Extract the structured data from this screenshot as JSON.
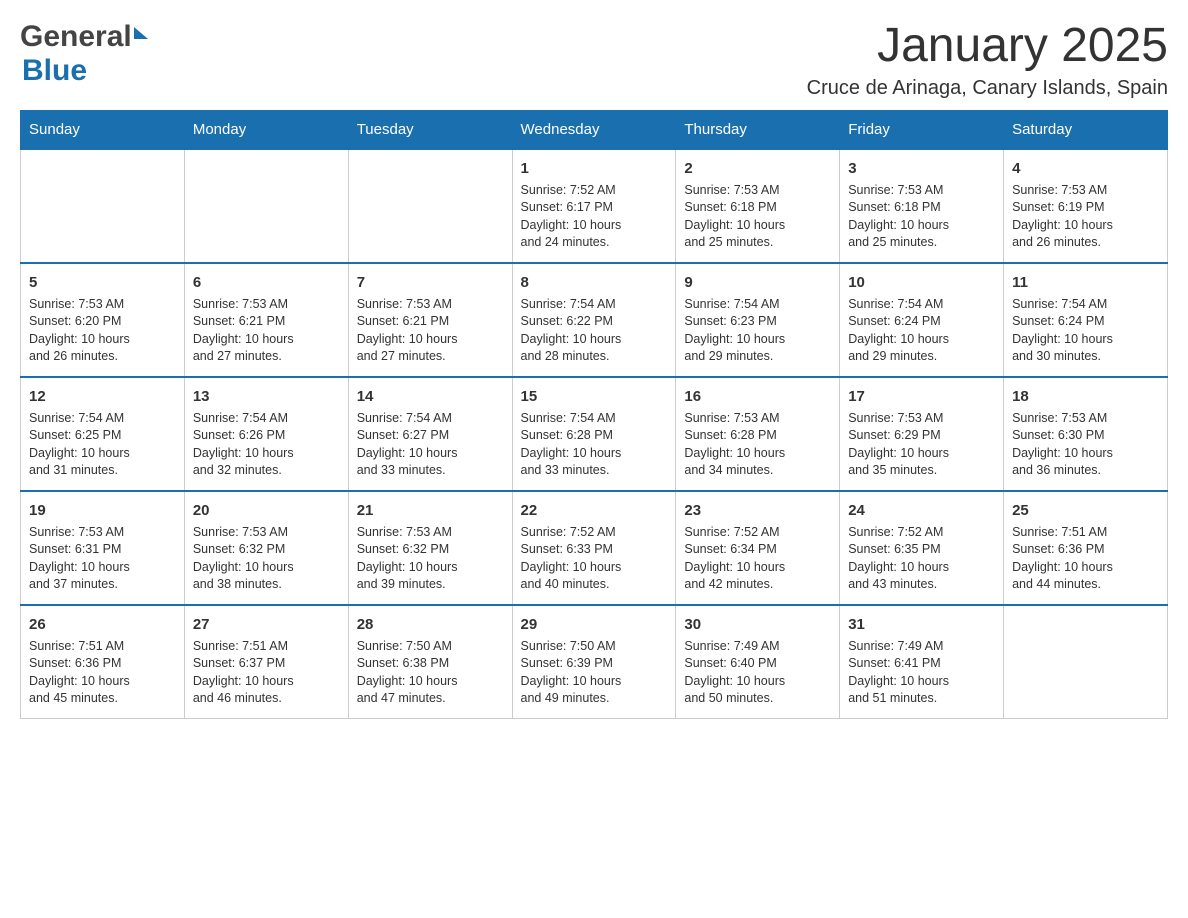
{
  "header": {
    "logo_general": "General",
    "logo_blue": "Blue",
    "month_title": "January 2025",
    "location": "Cruce de Arinaga, Canary Islands, Spain"
  },
  "days_of_week": [
    "Sunday",
    "Monday",
    "Tuesday",
    "Wednesday",
    "Thursday",
    "Friday",
    "Saturday"
  ],
  "weeks": [
    [
      {
        "day": "",
        "info": ""
      },
      {
        "day": "",
        "info": ""
      },
      {
        "day": "",
        "info": ""
      },
      {
        "day": "1",
        "info": "Sunrise: 7:52 AM\nSunset: 6:17 PM\nDaylight: 10 hours\nand 24 minutes."
      },
      {
        "day": "2",
        "info": "Sunrise: 7:53 AM\nSunset: 6:18 PM\nDaylight: 10 hours\nand 25 minutes."
      },
      {
        "day": "3",
        "info": "Sunrise: 7:53 AM\nSunset: 6:18 PM\nDaylight: 10 hours\nand 25 minutes."
      },
      {
        "day": "4",
        "info": "Sunrise: 7:53 AM\nSunset: 6:19 PM\nDaylight: 10 hours\nand 26 minutes."
      }
    ],
    [
      {
        "day": "5",
        "info": "Sunrise: 7:53 AM\nSunset: 6:20 PM\nDaylight: 10 hours\nand 26 minutes."
      },
      {
        "day": "6",
        "info": "Sunrise: 7:53 AM\nSunset: 6:21 PM\nDaylight: 10 hours\nand 27 minutes."
      },
      {
        "day": "7",
        "info": "Sunrise: 7:53 AM\nSunset: 6:21 PM\nDaylight: 10 hours\nand 27 minutes."
      },
      {
        "day": "8",
        "info": "Sunrise: 7:54 AM\nSunset: 6:22 PM\nDaylight: 10 hours\nand 28 minutes."
      },
      {
        "day": "9",
        "info": "Sunrise: 7:54 AM\nSunset: 6:23 PM\nDaylight: 10 hours\nand 29 minutes."
      },
      {
        "day": "10",
        "info": "Sunrise: 7:54 AM\nSunset: 6:24 PM\nDaylight: 10 hours\nand 29 minutes."
      },
      {
        "day": "11",
        "info": "Sunrise: 7:54 AM\nSunset: 6:24 PM\nDaylight: 10 hours\nand 30 minutes."
      }
    ],
    [
      {
        "day": "12",
        "info": "Sunrise: 7:54 AM\nSunset: 6:25 PM\nDaylight: 10 hours\nand 31 minutes."
      },
      {
        "day": "13",
        "info": "Sunrise: 7:54 AM\nSunset: 6:26 PM\nDaylight: 10 hours\nand 32 minutes."
      },
      {
        "day": "14",
        "info": "Sunrise: 7:54 AM\nSunset: 6:27 PM\nDaylight: 10 hours\nand 33 minutes."
      },
      {
        "day": "15",
        "info": "Sunrise: 7:54 AM\nSunset: 6:28 PM\nDaylight: 10 hours\nand 33 minutes."
      },
      {
        "day": "16",
        "info": "Sunrise: 7:53 AM\nSunset: 6:28 PM\nDaylight: 10 hours\nand 34 minutes."
      },
      {
        "day": "17",
        "info": "Sunrise: 7:53 AM\nSunset: 6:29 PM\nDaylight: 10 hours\nand 35 minutes."
      },
      {
        "day": "18",
        "info": "Sunrise: 7:53 AM\nSunset: 6:30 PM\nDaylight: 10 hours\nand 36 minutes."
      }
    ],
    [
      {
        "day": "19",
        "info": "Sunrise: 7:53 AM\nSunset: 6:31 PM\nDaylight: 10 hours\nand 37 minutes."
      },
      {
        "day": "20",
        "info": "Sunrise: 7:53 AM\nSunset: 6:32 PM\nDaylight: 10 hours\nand 38 minutes."
      },
      {
        "day": "21",
        "info": "Sunrise: 7:53 AM\nSunset: 6:32 PM\nDaylight: 10 hours\nand 39 minutes."
      },
      {
        "day": "22",
        "info": "Sunrise: 7:52 AM\nSunset: 6:33 PM\nDaylight: 10 hours\nand 40 minutes."
      },
      {
        "day": "23",
        "info": "Sunrise: 7:52 AM\nSunset: 6:34 PM\nDaylight: 10 hours\nand 42 minutes."
      },
      {
        "day": "24",
        "info": "Sunrise: 7:52 AM\nSunset: 6:35 PM\nDaylight: 10 hours\nand 43 minutes."
      },
      {
        "day": "25",
        "info": "Sunrise: 7:51 AM\nSunset: 6:36 PM\nDaylight: 10 hours\nand 44 minutes."
      }
    ],
    [
      {
        "day": "26",
        "info": "Sunrise: 7:51 AM\nSunset: 6:36 PM\nDaylight: 10 hours\nand 45 minutes."
      },
      {
        "day": "27",
        "info": "Sunrise: 7:51 AM\nSunset: 6:37 PM\nDaylight: 10 hours\nand 46 minutes."
      },
      {
        "day": "28",
        "info": "Sunrise: 7:50 AM\nSunset: 6:38 PM\nDaylight: 10 hours\nand 47 minutes."
      },
      {
        "day": "29",
        "info": "Sunrise: 7:50 AM\nSunset: 6:39 PM\nDaylight: 10 hours\nand 49 minutes."
      },
      {
        "day": "30",
        "info": "Sunrise: 7:49 AM\nSunset: 6:40 PM\nDaylight: 10 hours\nand 50 minutes."
      },
      {
        "day": "31",
        "info": "Sunrise: 7:49 AM\nSunset: 6:41 PM\nDaylight: 10 hours\nand 51 minutes."
      },
      {
        "day": "",
        "info": ""
      }
    ]
  ]
}
